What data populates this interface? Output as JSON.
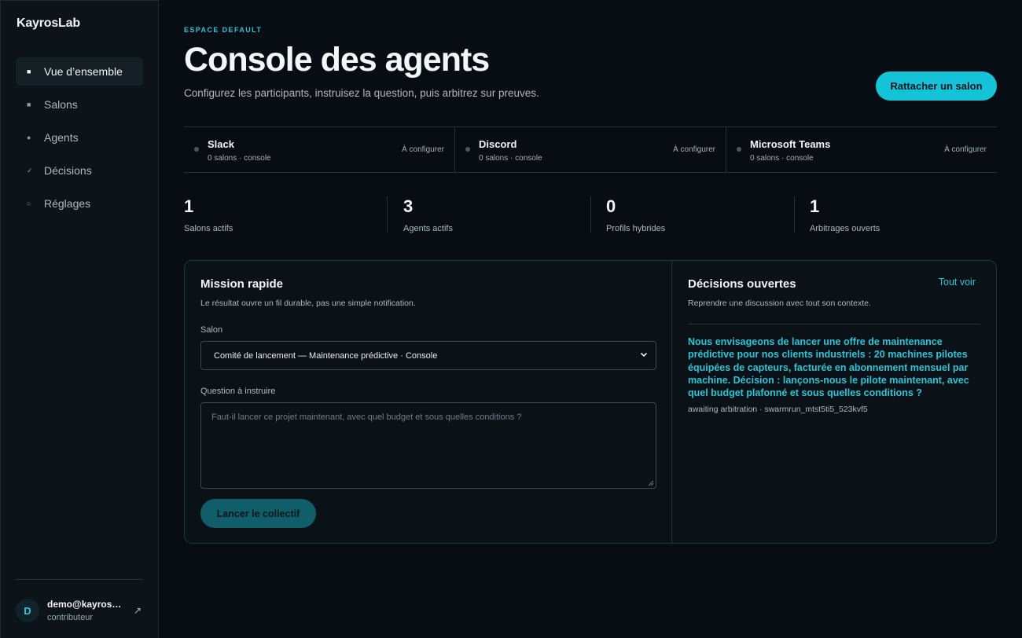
{
  "sidebar": {
    "brand": "KayrosLab",
    "items": [
      {
        "label": "Vue d’ensemble",
        "icon": "■",
        "active": true
      },
      {
        "label": "Salons",
        "icon": "■",
        "active": false
      },
      {
        "label": "Agents",
        "icon": "●",
        "active": false
      },
      {
        "label": "Décisions",
        "icon": "✓",
        "active": false
      },
      {
        "label": "Réglages",
        "icon": "○",
        "active": false
      }
    ],
    "user": {
      "initial": "D",
      "email": "demo@kayroslab.io",
      "role": "contributeur",
      "action_icon": "↗"
    }
  },
  "header": {
    "eyebrow": "ESPACE DEFAULT",
    "title": "Console des agents",
    "subtitle": "Configurez les participants, instruisez la question, puis arbitrez sur preuves.",
    "cta_label": "Rattacher un salon"
  },
  "integrations": [
    {
      "name": "Slack",
      "sub": "0 salons · console",
      "status": "À configurer"
    },
    {
      "name": "Discord",
      "sub": "0 salons · console",
      "status": "À configurer"
    },
    {
      "name": "Microsoft Teams",
      "sub": "0 salons · console",
      "status": "À configurer"
    }
  ],
  "stats": [
    {
      "value": "1",
      "label": "Salons actifs"
    },
    {
      "value": "3",
      "label": "Agents actifs"
    },
    {
      "value": "0",
      "label": "Profils hybrides"
    },
    {
      "value": "1",
      "label": "Arbitrages ouverts"
    }
  ],
  "mission": {
    "title": "Mission rapide",
    "subtitle": "Le résultat ouvre un fil durable, pas une simple notification.",
    "salon_label": "Salon",
    "salon_value": "Comité de lancement — Maintenance prédictive · Console",
    "question_label": "Question à instruire",
    "question_placeholder": "Faut-il lancer ce projet maintenant, avec quel budget et sous quelles conditions ?",
    "submit_label": "Lancer le collectif"
  },
  "decisions": {
    "title": "Décisions ouvertes",
    "see_all": "Tout voir",
    "subtitle": "Reprendre une discussion avec tout son contexte.",
    "item": {
      "title": "Nous envisageons de lancer une offre de maintenance prédictive pour nos clients industriels : 20 machines pilotes équipées de capteurs, facturée en abonnement mensuel par machine. Décision : lançons-nous le pilote maintenant, avec quel budget plafonné et sous quelles conditions ?",
      "meta": "awaiting arbitration · swarmrun_mtst5ti5_523kvf5"
    }
  },
  "colors": {
    "accent": "#15c3d9",
    "accent_text": "#2bc4d8",
    "background": "#070d12",
    "sidebar": "#0c1419",
    "border": "#26323a",
    "button_dim": "#0f5e6a"
  }
}
